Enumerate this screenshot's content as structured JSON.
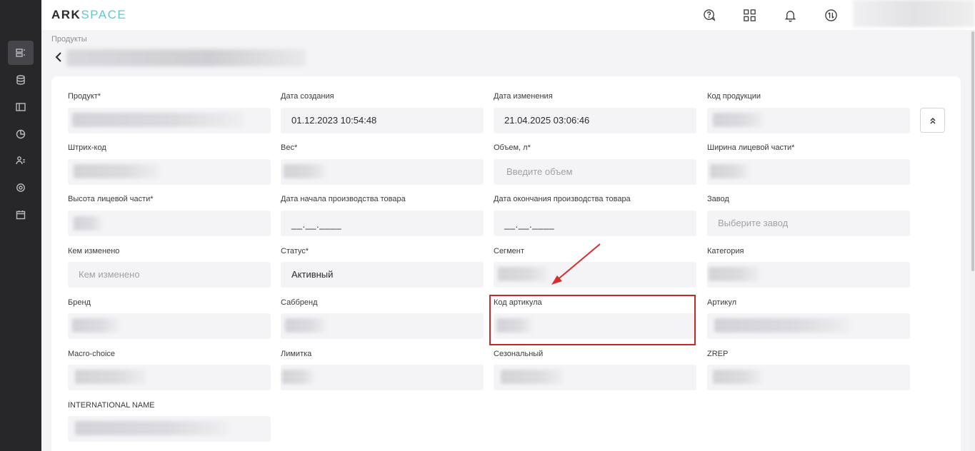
{
  "app": {
    "logo_ark": "ARK",
    "logo_space": "SPACE"
  },
  "sidebar": {
    "items": [
      {
        "icon": "products-icon",
        "active": true
      },
      {
        "icon": "database-icon",
        "active": false
      },
      {
        "icon": "layout-icon",
        "active": false
      },
      {
        "icon": "chart-pie-icon",
        "active": false
      },
      {
        "icon": "users-icon",
        "active": false
      },
      {
        "icon": "settings-icon",
        "active": false
      },
      {
        "icon": "calendar-icon",
        "active": false
      }
    ]
  },
  "header": {
    "icons": [
      "help-chat-icon",
      "apps-grid-icon",
      "notification-bell-icon",
      "sync-icon"
    ]
  },
  "breadcrumb": "Продукты",
  "form": {
    "product_label": "Продукт*",
    "created_label": "Дата создания",
    "created_value": "01.12.2023 10:54:48",
    "modified_label": "Дата изменения",
    "modified_value": "21.04.2025 03:06:46",
    "product_code_label": "Код продукции",
    "barcode_label": "Штрих-код",
    "weight_label": "Вес*",
    "volume_label": "Объем, л*",
    "volume_placeholder": "Введите объем",
    "face_width_label": "Ширина лицевой части*",
    "face_height_label": "Высота лицевой части*",
    "prod_start_label": "Дата начала производства товара",
    "prod_start_value": "__.__.____",
    "prod_end_label": "Дата окончания производства товара",
    "prod_end_value": "__.__.____",
    "plant_label": "Завод",
    "plant_placeholder": "Выберите завод",
    "modified_by_label": "Кем изменено",
    "modified_by_placeholder": "Кем изменено",
    "status_label": "Статус*",
    "status_value": "Активный",
    "segment_label": "Сегмент",
    "category_label": "Категория",
    "brand_label": "Бренд",
    "subbrand_label": "Саббренд",
    "article_code_label": "Код артикула",
    "article_label": "Артикул",
    "macro_choice_label": "Macro-choice",
    "limit_label": "Лимитка",
    "seasonal_label": "Сезональный",
    "zrep_label": "ZREP",
    "intl_name_label": "INTERNATIONAL NAME"
  },
  "annotation": {
    "color": "#c62828"
  }
}
